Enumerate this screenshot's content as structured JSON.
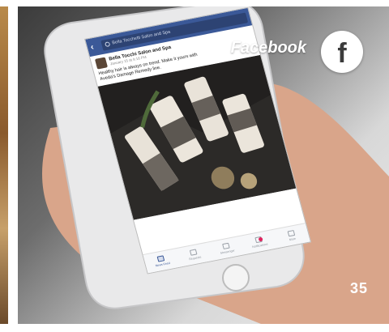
{
  "overlay": {
    "label": "Facebook",
    "badge_letter": "f",
    "page_number": "35"
  },
  "facebook": {
    "search_placeholder": "Bella Tocchetti Salon and Spa",
    "post": {
      "page_name": "Bella Tocchi Salon and Spa",
      "timestamp": "January 15 at 9:16 PM",
      "text": "Healthy hair is always on trend. Make it yours with Aveda's Damage Remedy line."
    },
    "tabs": [
      {
        "label": "News Feed",
        "icon": "news-feed-icon",
        "active": true
      },
      {
        "label": "Requests",
        "icon": "requests-icon",
        "active": false
      },
      {
        "label": "Messenger",
        "icon": "messenger-icon",
        "active": false
      },
      {
        "label": "Notifications",
        "icon": "notifications-icon",
        "active": false
      },
      {
        "label": "More",
        "icon": "more-icon",
        "active": false
      }
    ]
  },
  "colors": {
    "facebook_blue": "#3b5998",
    "badge_text": "#3b3b3b"
  }
}
